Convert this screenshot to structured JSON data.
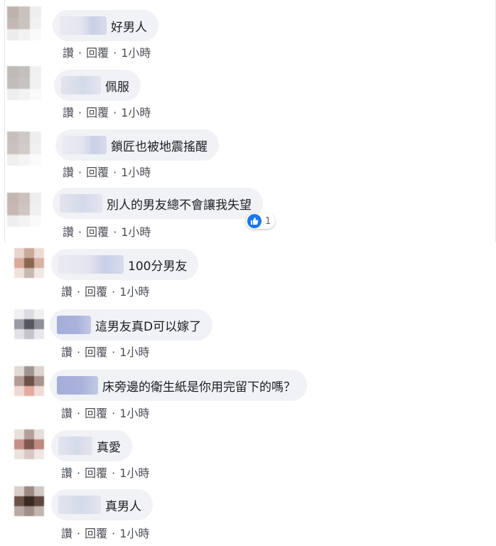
{
  "colors": {
    "bubble_bg": "#f0f2f5",
    "action_text": "#4b4f56",
    "like_blue": "#1877f2"
  },
  "action_labels": {
    "like": "讚",
    "reply": "回覆",
    "separator": "·"
  },
  "comments": [
    {
      "text": "好男人",
      "time": "1小時"
    },
    {
      "text": "佩服",
      "time": "1小時"
    },
    {
      "text": "鎖匠也被地震搖醒",
      "time": "1小時"
    },
    {
      "text": "別人的男友總不會讓我失望",
      "time": "1小時",
      "reaction_count": "1"
    },
    {
      "text": "100分男友",
      "time": "1小時"
    },
    {
      "text": "這男友真D可以嫁了",
      "time": "1小時"
    },
    {
      "text": "床旁邊的衛生紙是你用完留下的嗎？",
      "time": "1小時"
    },
    {
      "text": "真愛",
      "time": "1小時"
    },
    {
      "text": "真男人",
      "time": "1小時"
    }
  ]
}
